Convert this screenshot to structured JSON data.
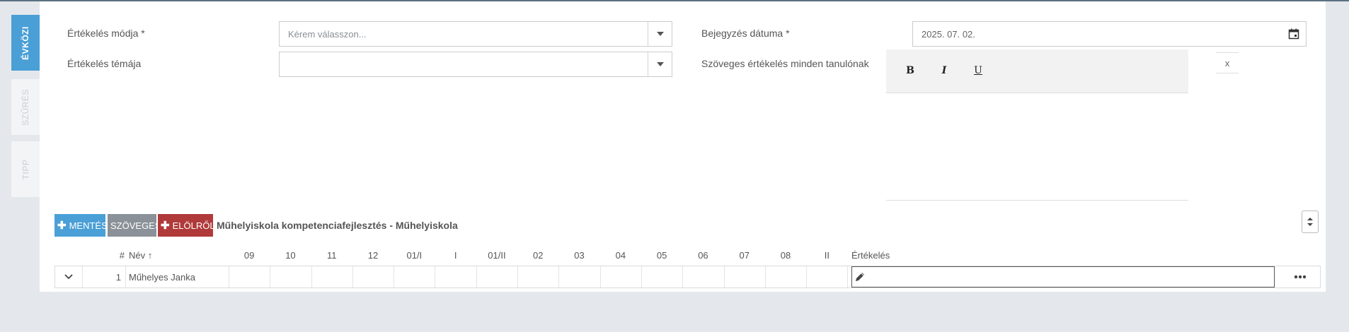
{
  "tabs": [
    {
      "label": "ÉVKÖZI",
      "active": true
    },
    {
      "label": "SZŰRÉS",
      "active": false
    },
    {
      "label": "TIPP",
      "active": false
    }
  ],
  "form": {
    "ertekeles_modja_label": "Értékelés módja *",
    "ertekeles_modja_placeholder": "Kérem válasszon...",
    "ertekeles_temaja_label": "Értékelés témája",
    "ertekeles_temaja_value": "",
    "bejegyzes_datuma_label": "Bejegyzés dátuma *",
    "bejegyzes_datuma_value": "2025. 07. 02.",
    "szoveges_label": "Szöveges értékelés minden tanulónak"
  },
  "editor": {
    "bold": "B",
    "italic": "I",
    "underline": "U",
    "clear": "x"
  },
  "toolbar": {
    "mentes": "MENTÉS",
    "szoveges": "SZÖVEGES",
    "elolrol": "ELÖLRŐL",
    "course": "Műhelyiskola kompetenciafejlesztés - Műhelyiskola"
  },
  "table": {
    "headers": {
      "index": "#",
      "name": "Név",
      "sort_arrow": "↑",
      "evaluation": "Értékelés"
    },
    "months": [
      "09",
      "10",
      "11",
      "12",
      "01/I",
      "I",
      "01/II",
      "02",
      "03",
      "04",
      "05",
      "06",
      "07",
      "08",
      "II"
    ],
    "rows": [
      {
        "index": "1",
        "name": "Műhelyes Janka"
      }
    ]
  },
  "colors": {
    "primary": "#4a9fd6",
    "secondary": "#8a9198",
    "danger": "#b03a3a"
  }
}
